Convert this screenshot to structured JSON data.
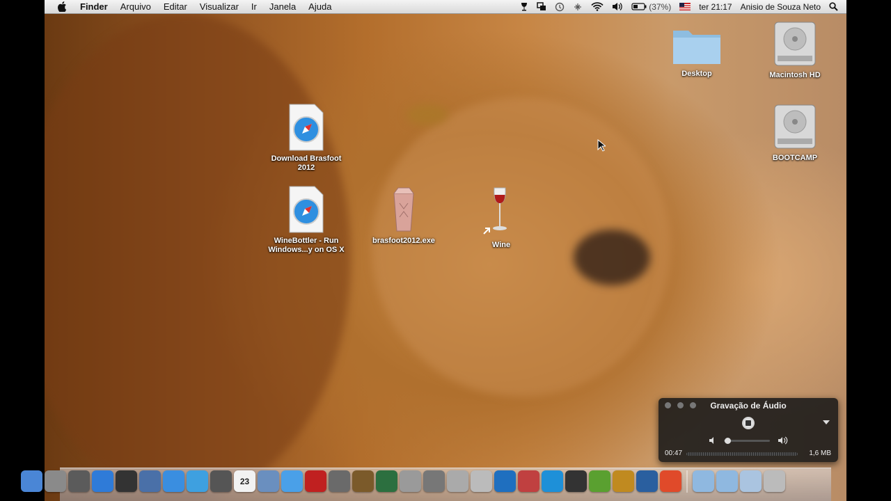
{
  "menubar": {
    "app_name": "Finder",
    "menus": [
      "Arquivo",
      "Editar",
      "Visualizar",
      "Ir",
      "Janela",
      "Ajuda"
    ],
    "battery": "(37%)",
    "clock": "ter 21:17",
    "user": "Anisio de Souza Neto"
  },
  "desktop": {
    "icons": [
      {
        "label": "Desktop",
        "icon": "folder-icon"
      },
      {
        "label": "Macintosh HD",
        "icon": "hard-drive-icon"
      },
      {
        "label": "BOOTCAMP",
        "icon": "hard-drive-icon"
      },
      {
        "label": "Download Brasfoot\n2012",
        "icon": "safari-webloc-icon"
      },
      {
        "label": "WineBottler - Run\nWindows...y on OS X",
        "icon": "safari-webloc-icon"
      },
      {
        "label": "brasfoot2012.exe",
        "icon": "exe-package-icon"
      },
      {
        "label": "Wine",
        "icon": "wine-glass-alias-icon"
      }
    ]
  },
  "audio_recorder": {
    "title": "Gravação de Áudio",
    "elapsed": "00:47",
    "file_size": "1,6 MB",
    "volume": 0.05
  },
  "dock": {
    "icons": [
      "finder-icon",
      "launchpad-icon",
      "activity-monitor-icon",
      "app-store-icon",
      "dashboard-icon",
      "preview-icon",
      "safari-icon",
      "facetime-icon",
      "photo-booth-icon",
      "calendar-icon",
      "iphoto-icon",
      "itunes-icon",
      "photo-app-icon",
      "utility-icon",
      "garageband-icon",
      "time-machine-icon",
      "disk-utility-icon",
      "camera-icon",
      "system-info-icon",
      "blocked-app-icon",
      "stocks-app-icon",
      "parallels-icon",
      "bluetooth-icon",
      "terminal-icon",
      "minecraft-icon",
      "burn-icon",
      "quicktime-icon",
      "chrome-icon",
      "applications-folder-icon",
      "documents-folder-icon",
      "downloads-icon",
      "trash-icon"
    ],
    "colors": [
      "#4a86d6",
      "#8a8a8a",
      "#5b5b5b",
      "#2f7bd8",
      "#333",
      "#4a70a8",
      "#3a8ee0",
      "#3ea0e0",
      "#555",
      "#f2f2f2",
      "#6a8fbf",
      "#4aa0e8",
      "#c02020",
      "#6a6a6a",
      "#7b5a2a",
      "#2c6f3f",
      "#9a9a9a",
      "#777",
      "#aaa",
      "#bbb",
      "#1f6fbf",
      "#c04040",
      "#1e90d8",
      "#333",
      "#5aa030",
      "#c08a20",
      "#2a5f9f",
      "#e04a2a",
      "#8fb8e0",
      "#8fb8e0",
      "#aac4e0",
      "#bbb"
    ]
  },
  "day_number": "23"
}
